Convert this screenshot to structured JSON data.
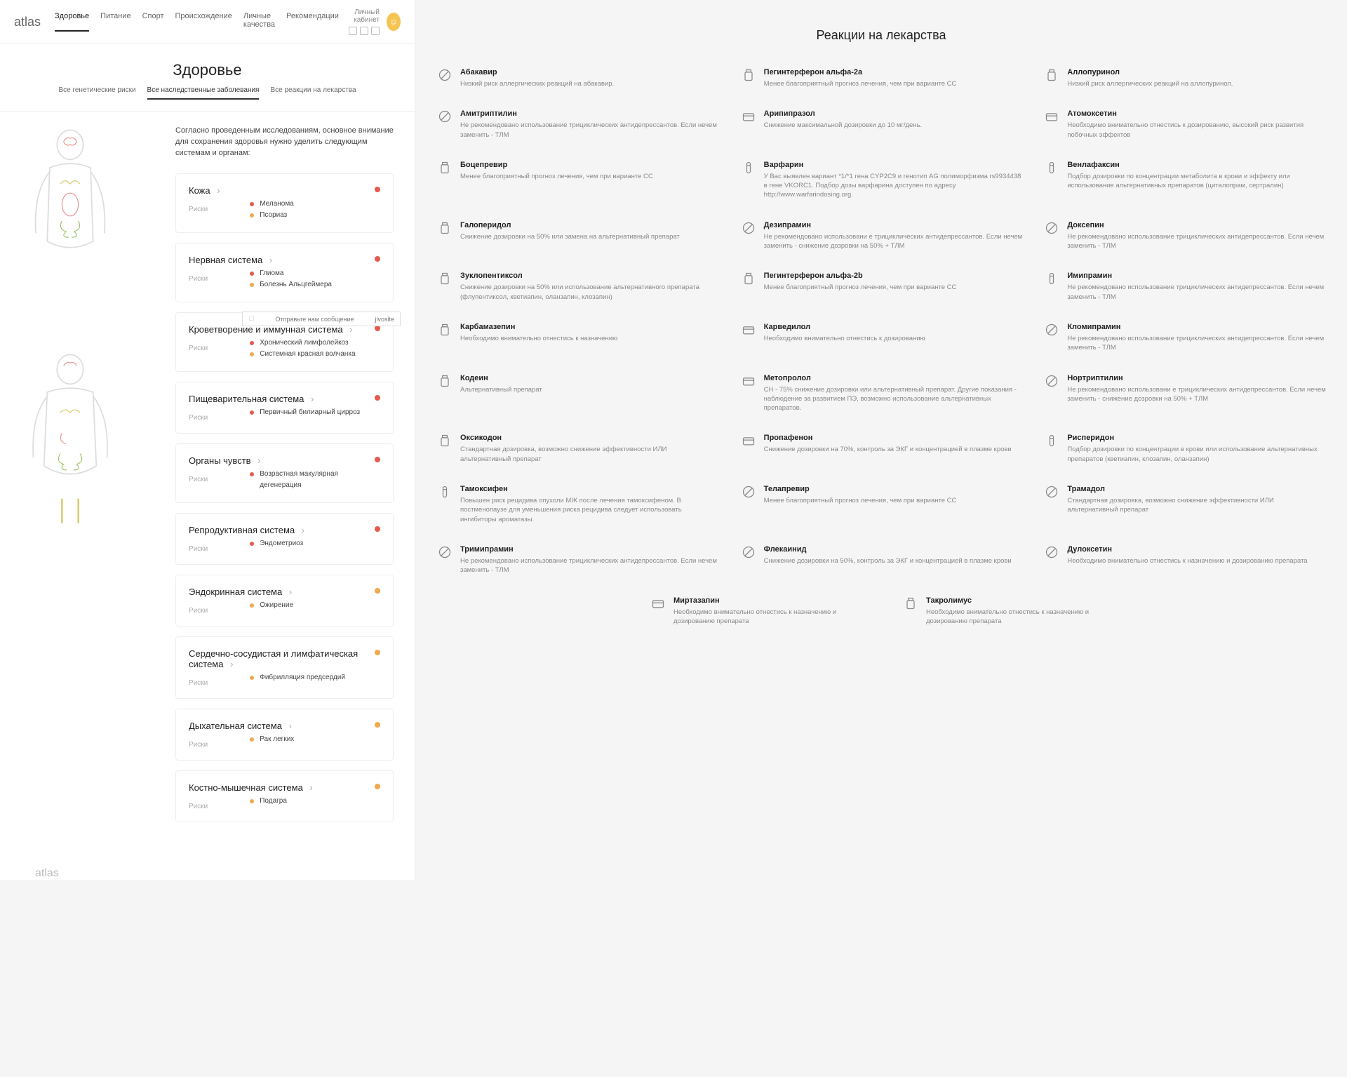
{
  "logo": "atlas",
  "nav": [
    "Здоровье",
    "Питание",
    "Спорт",
    "Происхождение",
    "Личные качества",
    "Рекомендации"
  ],
  "nav_active": 0,
  "account_label": "Личный кабинет",
  "page_title": "Здоровье",
  "subtabs": [
    "Все генетические риски",
    "Все наследственные заболевания",
    "Все реакции на лекарства"
  ],
  "subtab_active": 1,
  "intro": "Согласно проведенным исследованиям, основное внимание для сохранения здоровья нужно уделить следующим системам и органам:",
  "risks_label": "Риски",
  "chat_text": "Отправьте нам сообщение",
  "chat_brand": "jivosite",
  "systems": [
    {
      "title": "Кожа",
      "dot": "red",
      "risks": [
        {
          "c": "red",
          "t": "Меланома"
        },
        {
          "c": "orange",
          "t": "Псориаз"
        }
      ]
    },
    {
      "title": "Нервная система",
      "dot": "red",
      "risks": [
        {
          "c": "red",
          "t": "Глиома"
        },
        {
          "c": "orange",
          "t": "Болезнь Альцгеймера"
        }
      ]
    },
    {
      "title": "Кроветворение и иммунная система",
      "dot": "red",
      "risks": [
        {
          "c": "red",
          "t": "Хронический лимфолейкоз"
        },
        {
          "c": "orange",
          "t": "Системная красная волчанка"
        }
      ]
    },
    {
      "title": "Пищеварительная система",
      "dot": "red",
      "risks": [
        {
          "c": "red",
          "t": "Первичный билиарный цирроз"
        }
      ]
    },
    {
      "title": "Органы чувств",
      "dot": "red",
      "risks": [
        {
          "c": "red",
          "t": "Возрастная макулярная дегенерация"
        }
      ]
    },
    {
      "title": "Репродуктивная система",
      "dot": "red",
      "risks": [
        {
          "c": "red",
          "t": "Эндометриоз"
        }
      ]
    },
    {
      "title": "Эндокринная система",
      "dot": "orange",
      "risks": [
        {
          "c": "orange",
          "t": "Ожирение"
        }
      ]
    },
    {
      "title": "Сердечно-сосудистая и лимфатическая система",
      "dot": "orange",
      "risks": [
        {
          "c": "orange",
          "t": "Фибрилляция предсердий"
        }
      ]
    },
    {
      "title": "Дыхательная система",
      "dot": "orange",
      "risks": [
        {
          "c": "orange",
          "t": "Рак легких"
        }
      ]
    },
    {
      "title": "Костно-мышечная система",
      "dot": "orange",
      "risks": [
        {
          "c": "orange",
          "t": "Подагра"
        }
      ]
    }
  ],
  "right_title": "Реакции на лекарства",
  "drugs": [
    {
      "icon": "pill",
      "name": "Абакавир",
      "desc": "Низкий риск аллергических реакций на абакавир."
    },
    {
      "icon": "bottle",
      "name": "Пегинтерферон альфа-2a",
      "desc": "Менее благоприятный прогноз лечения, чем при варианте CC"
    },
    {
      "icon": "bottle",
      "name": "Аллопуринол",
      "desc": "Низкий риск аллергических реакций на аллопуринол."
    },
    {
      "icon": "pill",
      "name": "Амитриптилин",
      "desc": "Не рекомендовано использование трициклических антидепрессантов. Если нечем заменить - ТЛМ"
    },
    {
      "icon": "card",
      "name": "Арипипразол",
      "desc": "Снижение максимальной дозировки до 10 мг/день."
    },
    {
      "icon": "card",
      "name": "Атомоксетин",
      "desc": "Необходимо внимательно отнестись к дозированию, высокий риск развития побочных эффектов"
    },
    {
      "icon": "bottle",
      "name": "Боцепревир",
      "desc": "Менее благоприятный прогноз лечения, чем при варианте CC"
    },
    {
      "icon": "tube",
      "name": "Варфарин",
      "desc": "У Вас выявлен вариант *1/*1 гена CYP2C9 и генотип AG полиморфизма rs9934438 в гене VKORC1. Подбор дозы варфарина доступен по адресу http://www.warfarindosing.org."
    },
    {
      "icon": "tube",
      "name": "Венлафаксин",
      "desc": "Подбор дозировки по концентрации метаболита в крови и эффекту или использование альтернативных препаратов (циталопрам, сертралин)"
    },
    {
      "icon": "bottle",
      "name": "Галоперидол",
      "desc": "Снижение дозировки на 50% или замена на альтернативный препарат"
    },
    {
      "icon": "pill",
      "name": "Дезипрамин",
      "desc": "Не рекомендовано использовани е трициклических антидепрессантов. Если нечем заменить - снижение дозровки на 50% + ТЛМ"
    },
    {
      "icon": "pill",
      "name": "Доксепин",
      "desc": "Не рекомендовано использование трициклических антидепрессантов. Если нечем заменить - ТЛМ"
    },
    {
      "icon": "bottle",
      "name": "Зуклопентиксол",
      "desc": "Снижение дозировки на 50% или использование альтернативного препарата (флупентиксол, кветиапин, оланзапин, клозапин)"
    },
    {
      "icon": "bottle",
      "name": "Пегинтерферон альфа-2b",
      "desc": "Менее благоприятный прогноз лечения, чем при варианте CC"
    },
    {
      "icon": "tube",
      "name": "Имипрамин",
      "desc": "Не рекомендовано использование трициклических антидепрессантов. Если нечем заменить - ТЛМ"
    },
    {
      "icon": "bottle",
      "name": "Карбамазепин",
      "desc": "Необходимо внимательно отнестись к назначению"
    },
    {
      "icon": "card",
      "name": "Карведилол",
      "desc": "Необходимо внимательно отнестись к дозированию"
    },
    {
      "icon": "pill",
      "name": "Кломипрамин",
      "desc": "Не рекомендовано использование трициклических антидепрессантов. Если нечем заменить - ТЛМ"
    },
    {
      "icon": "bottle",
      "name": "Кодеин",
      "desc": "Альтернативный препарат"
    },
    {
      "icon": "card",
      "name": "Метопролол",
      "desc": "СН - 75% снижение дозировки или альтернативный препарат. Другие показания - наблюдение за развитием ПЭ, возможно использование альтернативных препаратов."
    },
    {
      "icon": "pill",
      "name": "Нортриптилин",
      "desc": "Не рекомендовано использовани е трициклических антидепрессантов. Если нечем заменить - снижение дозровки на 50% + ТЛМ"
    },
    {
      "icon": "bottle",
      "name": "Оксикодон",
      "desc": "Стандартная дозировка, возможно снижение эффективности ИЛИ альтернативный препарат"
    },
    {
      "icon": "card",
      "name": "Пропафенон",
      "desc": "Снижение дозировки на 70%, контроль за ЭКГ и концентрацией в плазме крови"
    },
    {
      "icon": "tube",
      "name": "Рисперидон",
      "desc": "Подбор дозировки по концентрации в крови или использование альтернативных препаратов (кветиапин, клозапин, оланзапин)"
    },
    {
      "icon": "tube",
      "name": "Тамоксифен",
      "desc": "Повышен риск рецидива опухоли МЖ после лечения тамоксифеном. В постменопаузе для уменьшения риска рецидива следует использовать ингибиторы ароматазы."
    },
    {
      "icon": "pill",
      "name": "Телапревир",
      "desc": "Менее благоприятный прогноз лечения, чем при варианте CC"
    },
    {
      "icon": "pill",
      "name": "Трамадол",
      "desc": "Стандартная дозировка, возможно снижение эффективности ИЛИ альтернативный препарат"
    },
    {
      "icon": "pill",
      "name": "Тримипрамин",
      "desc": "Не рекомендовано использование трициклических антидепрессантов. Если нечем заменить - ТЛМ"
    },
    {
      "icon": "pill",
      "name": "Флекаинид",
      "desc": "Снижение дозировки на 50%, контроль за ЭКГ и концентрацией в плазме крови"
    },
    {
      "icon": "pill",
      "name": "Дулоксетин",
      "desc": "Необходимо внимательно отнестись к назначению и дозированию препарата"
    }
  ],
  "drugs_bottom": [
    {
      "icon": "card",
      "name": "Миртазапин",
      "desc": "Необходимо внимательно отнестись к назначению и дозированию препарата"
    },
    {
      "icon": "bottle",
      "name": "Такролимус",
      "desc": "Необходимо внимательно отнестись к назначению и дозированию препарата"
    }
  ]
}
